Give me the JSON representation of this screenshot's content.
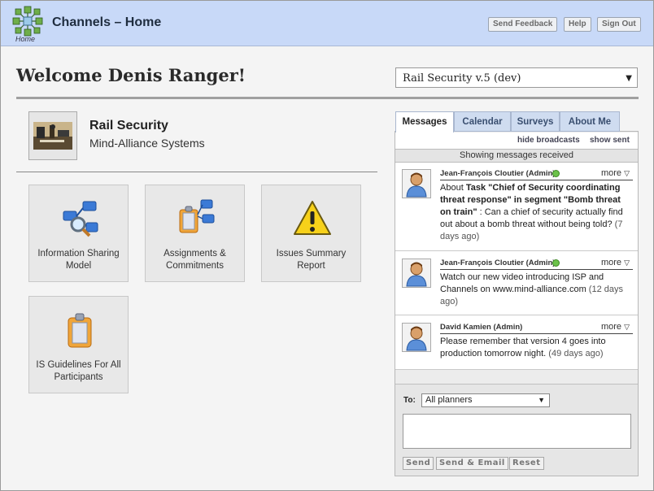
{
  "header": {
    "app_title": "Channels – Home",
    "logo_caption": "Home",
    "buttons": {
      "feedback": "Send Feedback",
      "help": "Help",
      "signout": "Sign Out"
    }
  },
  "welcome": {
    "text": "Welcome Denis Ranger!"
  },
  "plan_selector": {
    "selected": "Rail Security v.5 (dev)"
  },
  "organization": {
    "name": "Rail Security",
    "subtitle": "Mind-Alliance Systems"
  },
  "tiles": [
    {
      "label": "Information Sharing Model",
      "icon": "network-magnifier-icon"
    },
    {
      "label": "Assignments & Commitments",
      "icon": "clipboard-network-icon"
    },
    {
      "label": "Issues Summary Report",
      "icon": "warning-icon"
    },
    {
      "label": "IS Guidelines For All Participants",
      "icon": "clipboard-icon"
    }
  ],
  "tabs": [
    "Messages",
    "Calendar",
    "Surveys",
    "About Me"
  ],
  "messages_panel": {
    "hide_broadcasts": "hide broadcasts",
    "show_sent": "show sent",
    "showing": "Showing messages received",
    "more_label": "more",
    "items": [
      {
        "sender": "Jean-François Cloutier (Admin)",
        "online": true,
        "prefix": "About ",
        "bold": "Task \"Chief of Security coordinating threat response\" in segment \"Bomb threat on train\"",
        "text": " : Can a chief of security actually find out about a bomb threat without being told?",
        "age": " (7 days ago)"
      },
      {
        "sender": "Jean-François Cloutier (Admin)",
        "online": true,
        "prefix": "",
        "bold": "",
        "text": "Watch our new video introducing ISP and Channels on www.mind-alliance.com",
        "age": " (12 days ago)"
      },
      {
        "sender": "David Kamien (Admin)",
        "online": false,
        "prefix": "",
        "bold": "",
        "text": "Please remember that version 4 goes into production tomorrow night.",
        "age": " (49 days ago)"
      }
    ]
  },
  "composer": {
    "to_label": "To:",
    "to_selected": "All planners",
    "buttons": {
      "send": "Send",
      "send_email": "Send & Email",
      "reset": "Reset"
    }
  }
}
